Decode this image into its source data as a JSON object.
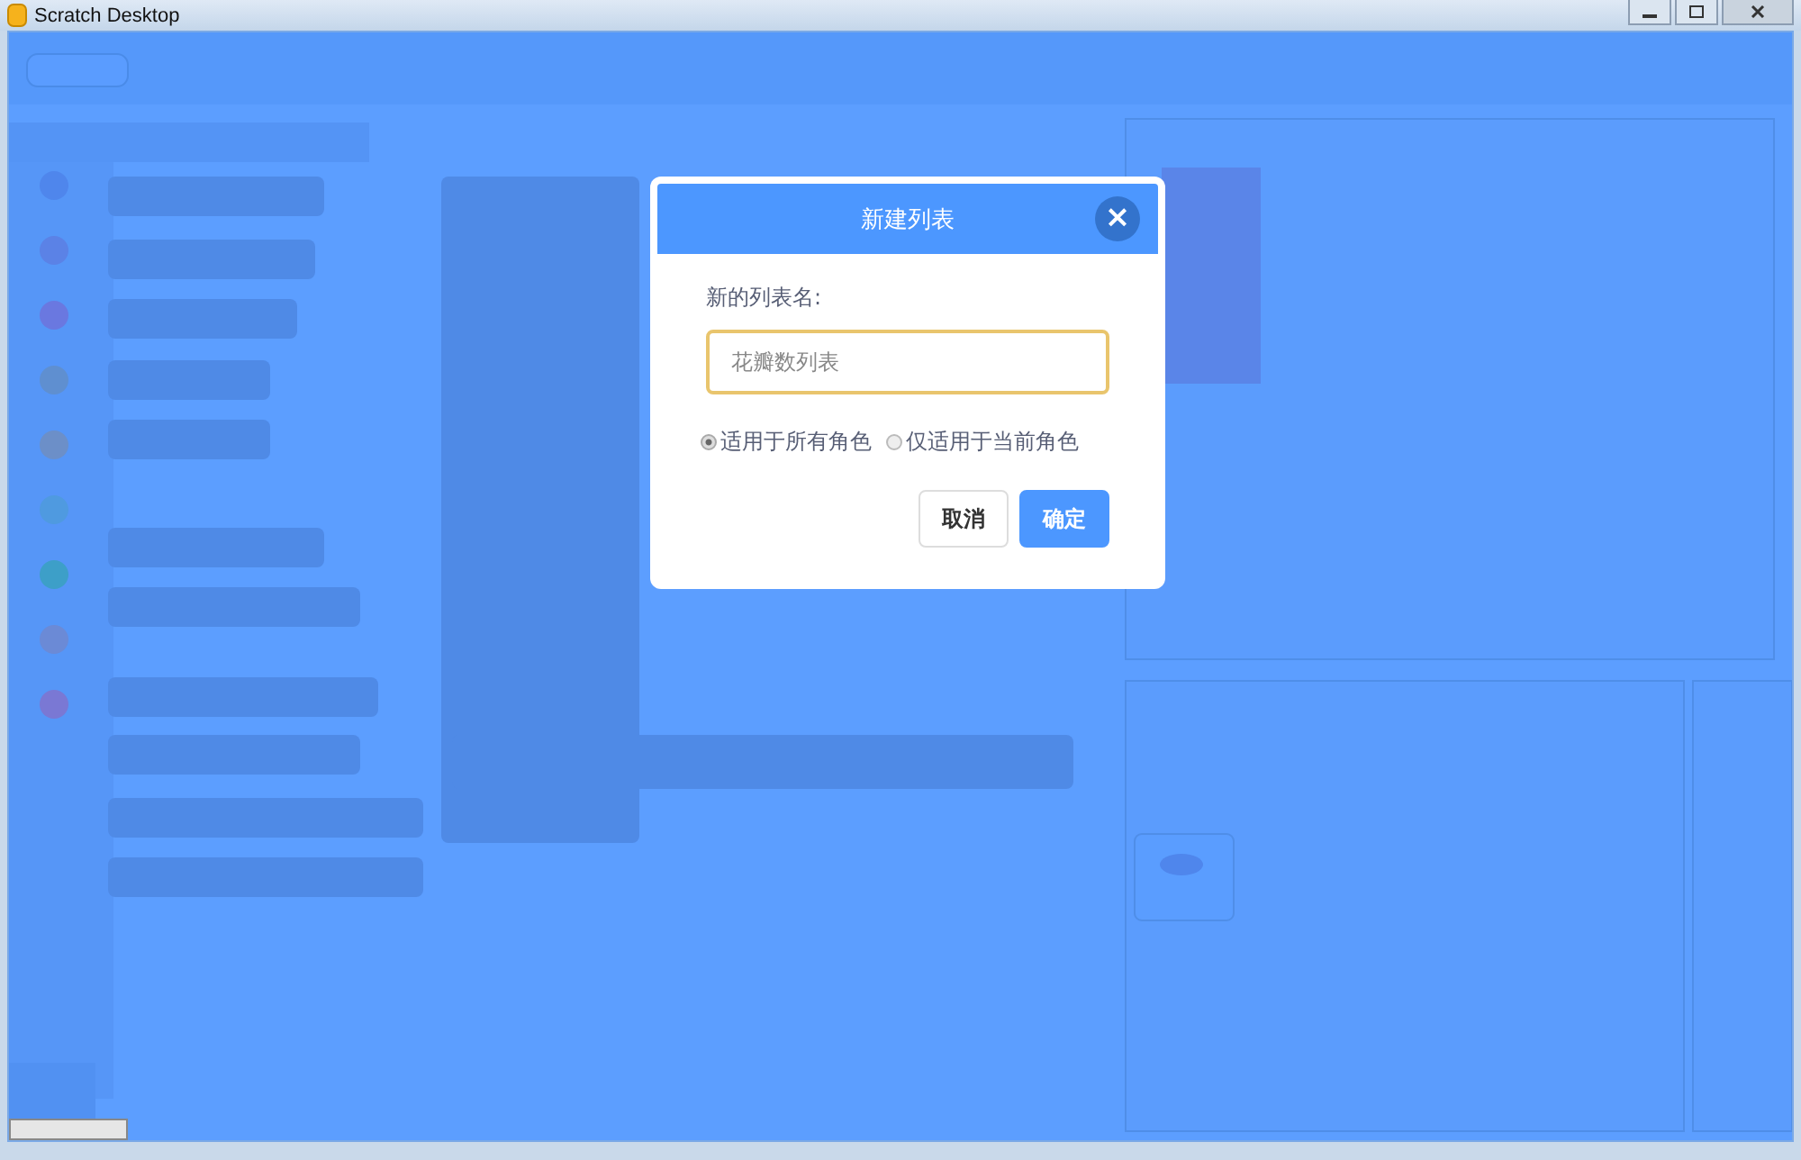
{
  "window": {
    "title": "Scratch Desktop"
  },
  "dialog": {
    "title": "新建列表",
    "close": "×",
    "label": "新的列表名:",
    "name_field": {
      "placeholder": "花瓣数列表"
    },
    "scope_options": [
      {
        "label": "适用于所有角色",
        "selected": true
      },
      {
        "label": "仅适用于当前角色",
        "selected": false
      }
    ],
    "buttons": [
      {
        "label": "取消",
        "kind": "secondary"
      },
      {
        "label": "确定",
        "kind": "primary"
      }
    ]
  }
}
